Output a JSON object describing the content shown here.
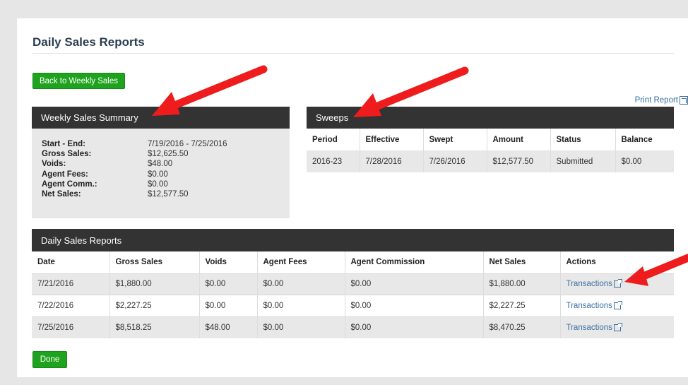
{
  "page": {
    "title": "Daily Sales Reports"
  },
  "buttons": {
    "back": "Back to Weekly Sales",
    "done": "Done",
    "print": "Print Report"
  },
  "summary": {
    "header": "Weekly Sales Summary",
    "rows": [
      {
        "label": "Start - End:",
        "value": "7/19/2016 - 7/25/2016"
      },
      {
        "label": "Gross Sales:",
        "value": "$12,625.50"
      },
      {
        "label": "Voids:",
        "value": "$48.00"
      },
      {
        "label": "Agent Fees:",
        "value": "$0.00"
      },
      {
        "label": "Agent Comm.:",
        "value": "$0.00"
      },
      {
        "label": "Net Sales:",
        "value": "$12,577.50"
      }
    ]
  },
  "sweeps": {
    "header": "Sweeps",
    "columns": [
      "Period",
      "Effective",
      "Swept",
      "Amount",
      "Status",
      "Balance"
    ],
    "rows": [
      [
        "2016-23",
        "7/28/2016",
        "7/26/2016",
        "$12,577.50",
        "Submitted",
        "$0.00"
      ]
    ]
  },
  "daily": {
    "header": "Daily Sales Reports",
    "columns": [
      "Date",
      "Gross Sales",
      "Voids",
      "Agent Fees",
      "Agent Commission",
      "Net Sales",
      "Actions"
    ],
    "rows": [
      [
        "7/21/2016",
        "$1,880.00",
        "$0.00",
        "$0.00",
        "$0.00",
        "$1,880.00",
        "Transactions"
      ],
      [
        "7/22/2016",
        "$2,227.25",
        "$0.00",
        "$0.00",
        "$0.00",
        "$2,227.25",
        "Transactions"
      ],
      [
        "7/25/2016",
        "$8,518.25",
        "$48.00",
        "$0.00",
        "$0.00",
        "$8,470.25",
        "Transactions"
      ]
    ]
  },
  "colors": {
    "accent_green": "#1fa31f",
    "header_dark": "#333333",
    "link_blue": "#3a6fa0",
    "arrow_red": "#ee1c1c"
  }
}
